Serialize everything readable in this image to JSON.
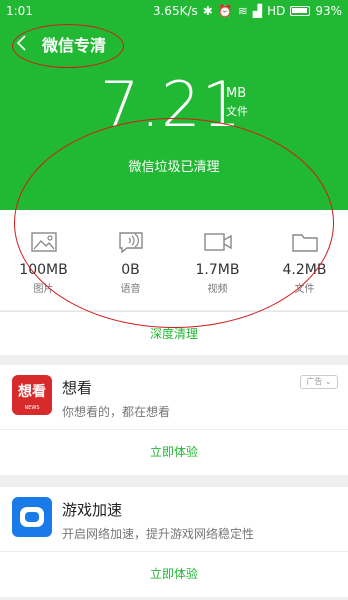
{
  "status": {
    "time": "1:01",
    "speed": "3.65K/s",
    "network": "HD",
    "battery": "93%"
  },
  "header": {
    "title": "微信专清",
    "size_value": "7.21",
    "size_unit": "MB",
    "size_sub": "文件",
    "status_text": "微信垃圾已清理"
  },
  "stats": [
    {
      "icon": "image-icon",
      "value": "100MB",
      "label": "图片"
    },
    {
      "icon": "voice-icon",
      "value": "0B",
      "label": "语音"
    },
    {
      "icon": "video-icon",
      "value": "1.7MB",
      "label": "视频"
    },
    {
      "icon": "folder-icon",
      "value": "4.2MB",
      "label": "文件"
    }
  ],
  "deep_clean": {
    "label": "深度清理"
  },
  "cards": [
    {
      "icon_text": "想看",
      "icon_sub": "NEWS",
      "name": "想看",
      "desc": "你想看的，都在想看",
      "ad": "广告 ⌄",
      "button": "立即体验"
    },
    {
      "name": "游戏加速",
      "desc": "开启网络加速，提升游戏网络稳定性",
      "button": "立即体验"
    }
  ],
  "colors": {
    "brand": "#21b833",
    "annotation": "#d21b1b"
  }
}
